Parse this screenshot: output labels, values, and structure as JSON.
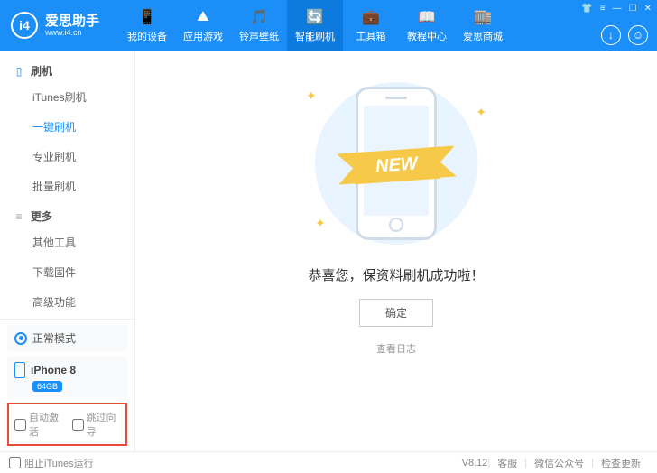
{
  "app": {
    "title": "爱思助手",
    "subtitle": "www.i4.cn",
    "logo_text": "i4"
  },
  "nav": {
    "items": [
      {
        "label": "我的设备",
        "icon": "📱"
      },
      {
        "label": "应用游戏",
        "icon": "⛰"
      },
      {
        "label": "铃声壁纸",
        "icon": "🎵"
      },
      {
        "label": "智能刷机",
        "icon": "🔄"
      },
      {
        "label": "工具箱",
        "icon": "💼"
      },
      {
        "label": "教程中心",
        "icon": "📖"
      },
      {
        "label": "爱思商城",
        "icon": "🏬"
      }
    ],
    "active_index": 3
  },
  "sidebar": {
    "sections": [
      {
        "title": "刷机",
        "icon": "📱",
        "items": [
          "iTunes刷机",
          "一键刷机",
          "专业刷机",
          "批量刷机"
        ],
        "active_index": 1
      },
      {
        "title": "更多",
        "icon": "≡",
        "items": [
          "其他工具",
          "下载固件",
          "高级功能"
        ],
        "active_index": -1
      }
    ],
    "mode": "正常模式",
    "device": {
      "name": "iPhone 8",
      "storage": "64GB"
    },
    "options": {
      "auto_activate": "自动激活",
      "skip_guide": "跳过向导"
    }
  },
  "main": {
    "ribbon": "NEW",
    "message": "恭喜您，保资料刷机成功啦！",
    "confirm": "确定",
    "view_log": "查看日志"
  },
  "footer": {
    "block_itunes": "阻止iTunes运行",
    "version": "V8.12",
    "links": [
      "客服",
      "微信公众号",
      "检查更新"
    ]
  }
}
